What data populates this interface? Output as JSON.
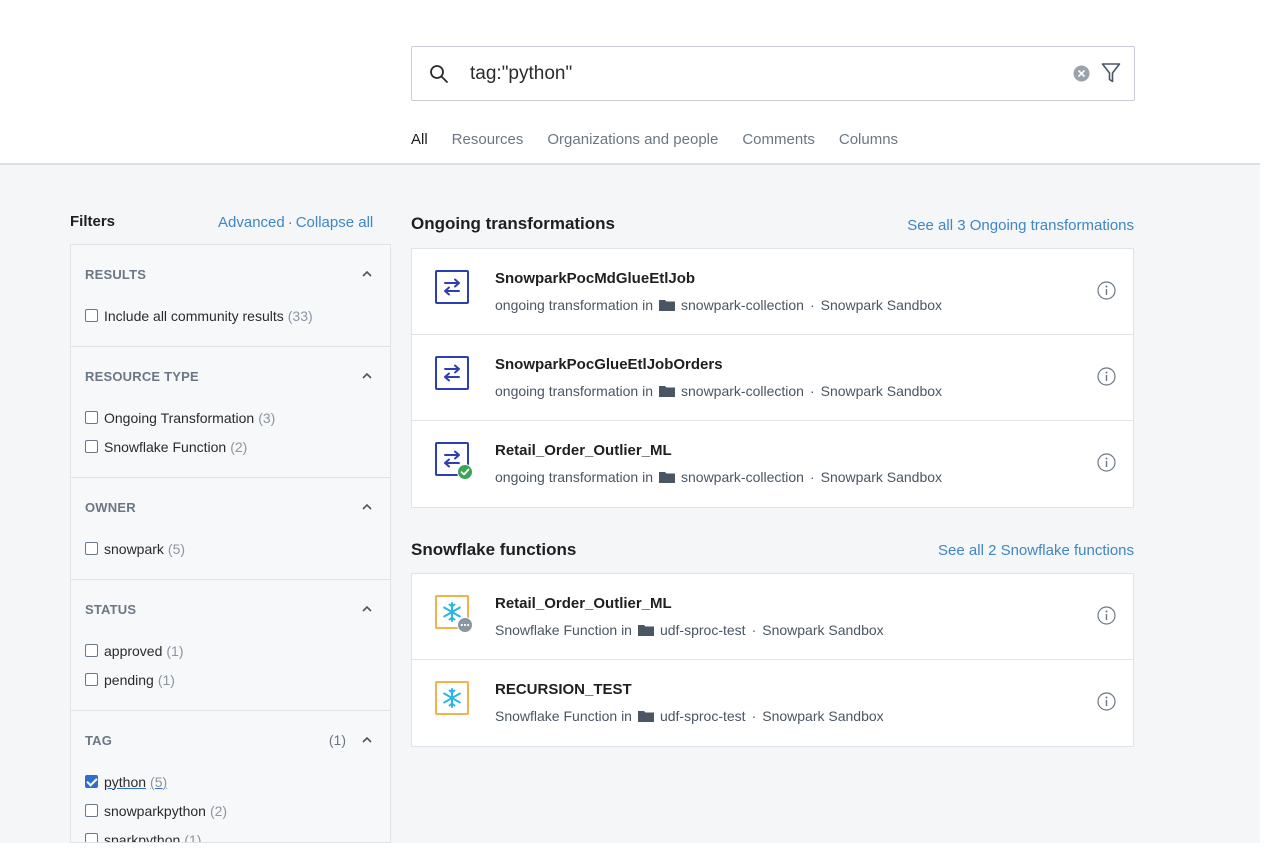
{
  "search": {
    "query": "tag:\"python\"",
    "icon": "search-icon",
    "clear_icon": "clear-circle-icon",
    "filter_icon": "funnel-icon"
  },
  "tabs": [
    {
      "label": "All",
      "active": true
    },
    {
      "label": "Resources",
      "active": false
    },
    {
      "label": "Organizations and people",
      "active": false
    },
    {
      "label": "Comments",
      "active": false
    },
    {
      "label": "Columns",
      "active": false
    }
  ],
  "filters": {
    "heading": "Filters",
    "advanced": "Advanced",
    "separator": "·",
    "collapse_all": "Collapse all",
    "sections": [
      {
        "title": "RESULTS",
        "count": "",
        "options": [
          {
            "label": "Include all community results",
            "count": "(33)",
            "checked": false
          }
        ]
      },
      {
        "title": "RESOURCE TYPE",
        "count": "",
        "options": [
          {
            "label": "Ongoing Transformation",
            "count": "(3)",
            "checked": false
          },
          {
            "label": "Snowflake Function",
            "count": "(2)",
            "checked": false
          }
        ]
      },
      {
        "title": "OWNER",
        "count": "",
        "options": [
          {
            "label": "snowpark",
            "count": "(5)",
            "checked": false
          }
        ]
      },
      {
        "title": "STATUS",
        "count": "",
        "options": [
          {
            "label": "approved",
            "count": "(1)",
            "checked": false
          },
          {
            "label": "pending",
            "count": "(1)",
            "checked": false
          }
        ]
      },
      {
        "title": "TAG",
        "count": "(1)",
        "options": [
          {
            "label": "python",
            "count": "(5)",
            "checked": true
          },
          {
            "label": "snowparkpython",
            "count": "(2)",
            "checked": false
          },
          {
            "label": "sparkpython",
            "count": "(1)",
            "checked": false
          }
        ]
      }
    ]
  },
  "groups": [
    {
      "title": "Ongoing transformations",
      "see_all": "See all 3 Ongoing transformations",
      "items": [
        {
          "title": "SnowparkPocMdGlueEtlJob",
          "type_text": "ongoing transformation in",
          "collection": "snowpark-collection",
          "separator": "·",
          "org": "Snowpark Sandbox",
          "icon": "transform-arrows-icon",
          "badge": ""
        },
        {
          "title": "SnowparkPocGlueEtlJobOrders",
          "type_text": "ongoing transformation in",
          "collection": "snowpark-collection",
          "separator": "·",
          "org": "Snowpark Sandbox",
          "icon": "transform-arrows-icon",
          "badge": ""
        },
        {
          "title": "Retail_Order_Outlier_ML",
          "type_text": "ongoing transformation in",
          "collection": "snowpark-collection",
          "separator": "·",
          "org": "Snowpark Sandbox",
          "icon": "transform-arrows-icon",
          "badge": "approved-check-badge-icon"
        }
      ]
    },
    {
      "title": "Snowflake functions",
      "see_all": "See all 2 Snowflake functions",
      "items": [
        {
          "title": "Retail_Order_Outlier_ML",
          "type_text": "Snowflake Function in",
          "collection": "udf-sproc-test",
          "separator": "·",
          "org": "Snowpark Sandbox",
          "icon": "snowflake-icon",
          "badge": "pending-dots-badge-icon"
        },
        {
          "title": "RECURSION_TEST",
          "type_text": "Snowflake Function in",
          "collection": "udf-sproc-test",
          "separator": "·",
          "org": "Snowpark Sandbox",
          "icon": "snowflake-icon",
          "badge": ""
        }
      ]
    }
  ],
  "colors": {
    "accent_link": "#3f86c4",
    "tab_underline": "#6fb6d8",
    "transform_icon": "#2d3fb5",
    "snowflake_icon_border": "#f0b24a",
    "snowflake_icon": "#29b5e8",
    "approved_badge": "#3aa655",
    "pending_badge": "#8b95a1"
  }
}
